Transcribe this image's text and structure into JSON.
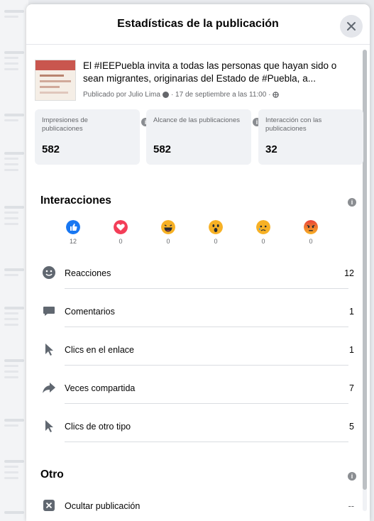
{
  "dialog": {
    "title": "Estadísticas de la publicación",
    "close_icon": "close-icon"
  },
  "post": {
    "text": "El #IEEPuebla invita a todas las personas que hayan sido o sean migrantes, originarias del Estado de #Puebla, a...",
    "meta": "Publicado por Julio Lima",
    "meta_date": "· 17 de septiembre a las 11:00 ·"
  },
  "stats": [
    {
      "label": "Impresiones de publicaciones",
      "value": "582"
    },
    {
      "label": "Alcance de las publicaciones",
      "value": "582"
    },
    {
      "label": "Interacción con las publicaciones",
      "value": "32"
    }
  ],
  "interacciones": {
    "title": "Interacciones",
    "reactions": [
      {
        "icon": "like-icon",
        "count": "12",
        "color": "#1877f2"
      },
      {
        "icon": "love-icon",
        "count": "0",
        "color": "#f33e58"
      },
      {
        "icon": "haha-icon",
        "count": "0",
        "color": "#f7b125"
      },
      {
        "icon": "wow-icon",
        "count": "0",
        "color": "#f7b125"
      },
      {
        "icon": "sad-icon",
        "count": "0",
        "color": "#f7b125"
      },
      {
        "icon": "angry-icon",
        "count": "0",
        "color": "#e9710f"
      }
    ],
    "metrics": [
      {
        "icon": "smiley-icon",
        "label": "Reacciones",
        "value": "12"
      },
      {
        "icon": "comment-icon",
        "label": "Comentarios",
        "value": "1"
      },
      {
        "icon": "cursor-icon",
        "label": "Clics en el enlace",
        "value": "1"
      },
      {
        "icon": "share-icon",
        "label": "Veces compartida",
        "value": "7"
      },
      {
        "icon": "cursor-icon",
        "label": "Clics de otro tipo",
        "value": "5"
      }
    ]
  },
  "otro": {
    "title": "Otro",
    "items": [
      {
        "icon": "hide-icon",
        "label": "Ocultar publicación",
        "value": "--"
      }
    ]
  }
}
